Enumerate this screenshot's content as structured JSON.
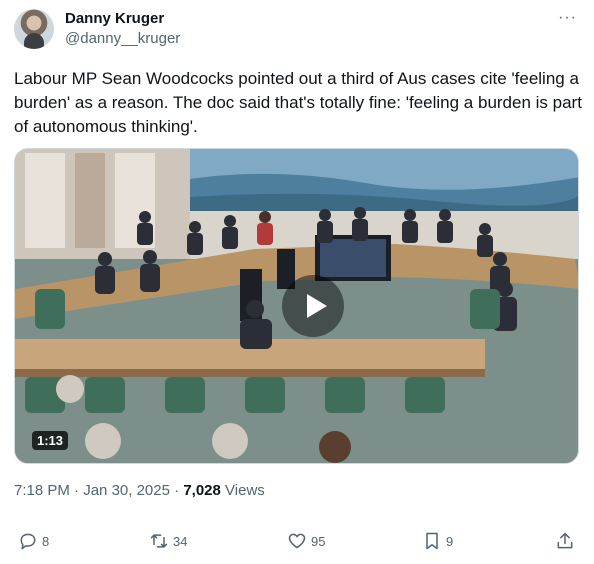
{
  "author": {
    "name": "Danny Kruger",
    "handle": "@danny__kruger"
  },
  "more_label": "···",
  "tweet": {
    "text": "Labour MP Sean Woodcocks pointed out a third of Aus cases cite 'feeling a burden' as a reason. The doc said that's totally fine: 'feeling a burden is part of autonomous thinking'."
  },
  "video": {
    "duration": "1:13"
  },
  "meta": {
    "time": "7:18 PM",
    "date": "Jan 30, 2025",
    "views_count": "7,028",
    "views_label": "Views"
  },
  "actions": {
    "replies": "8",
    "reposts": "34",
    "likes": "95",
    "bookmarks": "9"
  },
  "icons": [
    "reply-icon",
    "repost-icon",
    "like-icon",
    "bookmark-icon",
    "share-icon",
    "play-icon",
    "more-icon"
  ]
}
